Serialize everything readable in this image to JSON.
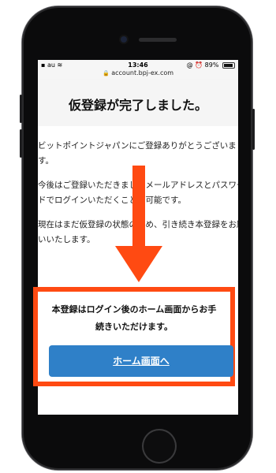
{
  "status_bar": {
    "carrier": "au",
    "time": "13:46",
    "battery_text": "89%",
    "battery_level": 0.89
  },
  "browser": {
    "url": "account.bpj-ex.com"
  },
  "page": {
    "title": "仮登録が完了しました。",
    "paragraphs": [
      "ビットポイントジャパンにご登録ありがとうございます。",
      "今後はご登録いただきましたメールアドレスとパスワードでログインいただくことが可能です。",
      "現在はまだ仮登録の状態のため、引き続き本登録をお願いいたします。"
    ]
  },
  "notice": {
    "line1": "本登録はログイン後のホーム画面からお手",
    "line2": "続きいただけます。",
    "button_label": "ホーム画面へ"
  },
  "colors": {
    "accent": "#ff4a12",
    "button": "#2f80c8"
  },
  "icons": {
    "wifi": "wifi-icon",
    "lock": "lock-icon",
    "alarm": "alarm-icon",
    "battery": "battery-icon",
    "arrow": "down-arrow-icon"
  }
}
